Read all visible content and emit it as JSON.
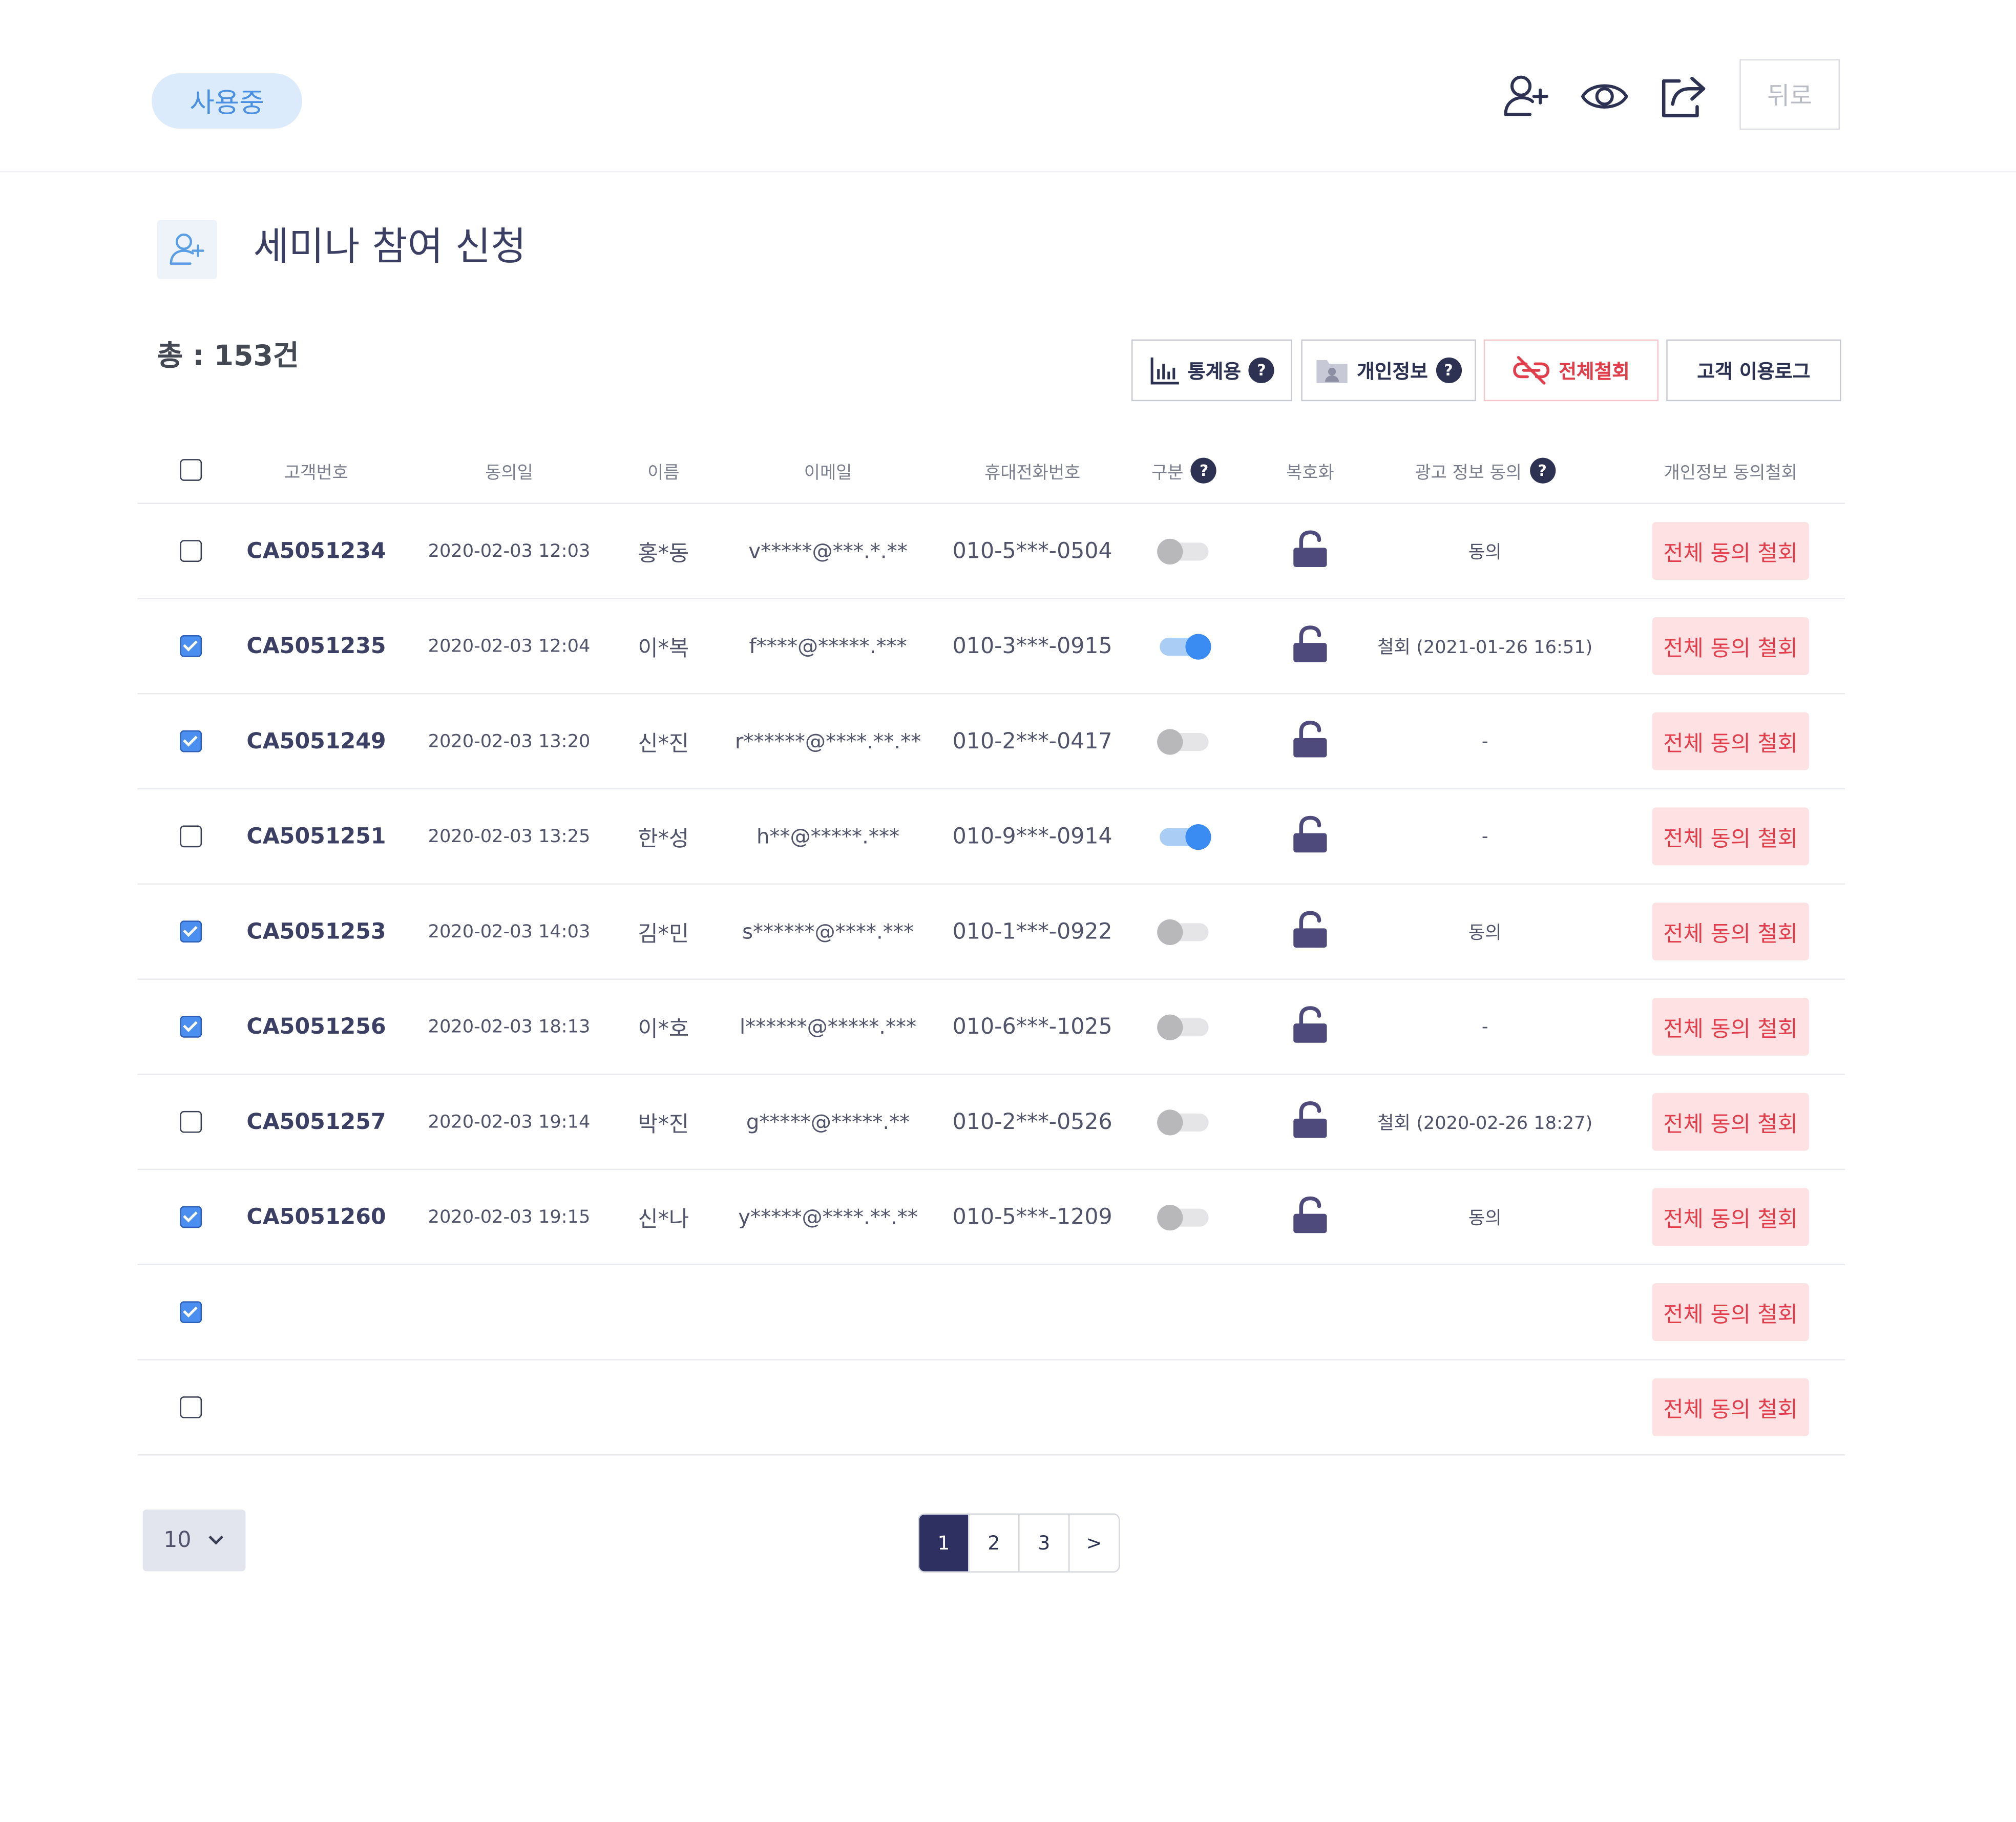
{
  "header": {
    "status_label": "사용중",
    "back_label": "뒤로"
  },
  "title": "세미나 참여 신청",
  "total_label": "총 : 153건",
  "toolbar": {
    "stats_label": "통계용",
    "personal_label": "개인정보",
    "revoke_all_label": "전체철회",
    "log_label": "고객 이용로그",
    "help_mark": "?"
  },
  "table": {
    "columns": {
      "id": "고객번호",
      "date": "동의일",
      "name": "이름",
      "email": "이메일",
      "phone": "휴대전화번호",
      "type": "구분",
      "decrypt": "복호화",
      "ad": "광고 정보 동의",
      "withdraw": "개인정보 동의철회"
    },
    "withdraw_label": "전체 동의 철회",
    "rows": [
      {
        "checked": false,
        "id": "CA5051234",
        "date": "2020-02-03 12:03",
        "name": "홍*동",
        "email": "v*****@***.*.**",
        "phone": "010-5***-0504",
        "toggle": false,
        "ad": "동의"
      },
      {
        "checked": true,
        "id": "CA5051235",
        "date": "2020-02-03 12:04",
        "name": "이*복",
        "email": "f****@*****.***",
        "phone": "010-3***-0915",
        "toggle": true,
        "ad": "철회 (2021-01-26 16:51)"
      },
      {
        "checked": true,
        "id": "CA5051249",
        "date": "2020-02-03 13:20",
        "name": "신*진",
        "email": "r******@****.**.**",
        "phone": "010-2***-0417",
        "toggle": false,
        "ad": "-"
      },
      {
        "checked": false,
        "id": "CA5051251",
        "date": "2020-02-03 13:25",
        "name": "한*성",
        "email": "h**@*****.***",
        "phone": "010-9***-0914",
        "toggle": true,
        "ad": "-"
      },
      {
        "checked": true,
        "id": "CA5051253",
        "date": "2020-02-03 14:03",
        "name": "김*민",
        "email": "s******@****.***",
        "phone": "010-1***-0922",
        "toggle": false,
        "ad": "동의"
      },
      {
        "checked": true,
        "id": "CA5051256",
        "date": "2020-02-03 18:13",
        "name": "이*호",
        "email": "l******@*****.***",
        "phone": "010-6***-1025",
        "toggle": false,
        "ad": "-"
      },
      {
        "checked": false,
        "id": "CA5051257",
        "date": "2020-02-03 19:14",
        "name": "박*진",
        "email": "g*****@*****.**",
        "phone": "010-2***-0526",
        "toggle": false,
        "ad": "철회 (2020-02-26 18:27)"
      },
      {
        "checked": true,
        "id": "CA5051260",
        "date": "2020-02-03 19:15",
        "name": "신*나",
        "email": "y*****@****.**.**",
        "phone": "010-5***-1209",
        "toggle": false,
        "ad": "동의"
      },
      {
        "checked": true,
        "empty": true
      },
      {
        "checked": false,
        "empty": true
      }
    ]
  },
  "footer": {
    "page_size": "10",
    "pages": [
      "1",
      "2",
      "3"
    ],
    "current_page": "1",
    "next_label": ">"
  },
  "colors": {
    "accent": "#3b8cf2",
    "danger": "#e23d4b",
    "primary_dark": "#2d3060"
  },
  "icons": {
    "top_add_user": "user-plus-icon",
    "top_view": "eye-icon",
    "top_share": "share-icon",
    "title": "user-plus-icon",
    "stats": "bar-chart-icon",
    "personal": "folder-user-icon",
    "revoke": "unlink-icon",
    "decrypt": "unlock-icon",
    "page_size": "chevron-down-icon"
  }
}
